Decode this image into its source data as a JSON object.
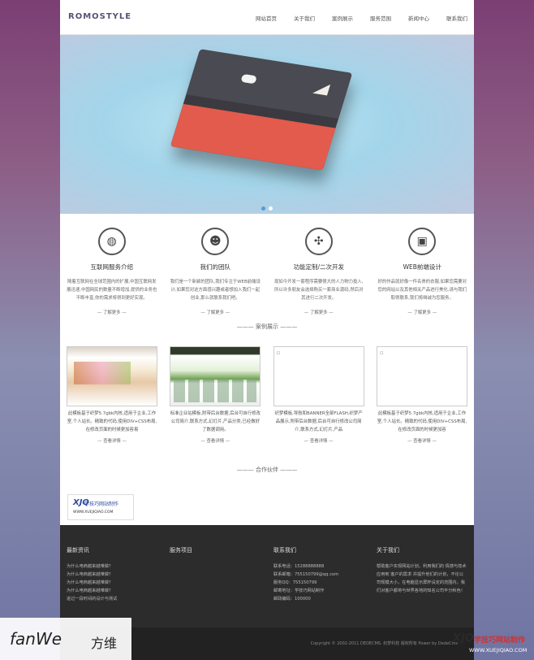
{
  "brand": "ROMOSTYLE",
  "nav": [
    "网站首页",
    "关于我们",
    "案例展示",
    "服务范围",
    "新闻中心",
    "联系我们"
  ],
  "banner": {
    "slides": 2,
    "active_slide": 1
  },
  "services": [
    {
      "icon": "globe-icon",
      "glyph": "◍",
      "title": "互联网服务介绍",
      "desc": "随着互联网在全球范围内的扩展,中国互联网发展迅速,中国网民的数量不断增加,提供的业务也不断丰富,你的需求将得到更好实现。",
      "more": "— 了解更多 —"
    },
    {
      "icon": "team-icon",
      "glyph": "☻",
      "title": "我们的团队",
      "desc": "我们是一个新颖的团队,我们专注于WEB前端设计,如果您对这方面感兴趣或者想加入我们一起创业,那么就联系我们吧。",
      "more": "— 了解更多 —"
    },
    {
      "icon": "compress-icon",
      "glyph": "✣",
      "title": "功能定制/二次开发",
      "desc": "现如今开发一套程序需要很大的人力物力投入,所以许多朋友会选择购买一套商业源码,然后对其进行二次开发。",
      "more": "— 了解更多 —"
    },
    {
      "icon": "laptop-icon",
      "glyph": "▣",
      "title": "WEB前端设计",
      "desc": "好的作品就好像一件名贵的衣服,如果您需要对您的网站以及其他相关产品进行美化,请与我们取得联系,我们将竭诚为您服务。",
      "more": "— 了解更多 —"
    }
  ],
  "cases_title": "——— 案例展示 ———",
  "cases": [
    {
      "desc": "此模板基于织梦5.7gbk内核,适用于企业,工作室,个人站长。精致的代码,使用DIV+CSS布局,在修改页面的时候更加容易",
      "more": "— 查看详情 —"
    },
    {
      "desc": "标准企业站模板,附带后台数据,后台可自行修改公司简介,联系方式,幻灯片,产品分类,已经做好了数据调用。",
      "more": "— 查看详情 —"
    },
    {
      "desc": "织梦模板,导航和BANNER全部FLASH,织梦产品展示,附带后台数据,后台可自行修改公司简介,联系方式,幻灯片,产品",
      "more": "— 查看详情 —"
    },
    {
      "desc": "此模板基于织梦5.7gbk内核,适用于企业,工作室,个人站长。精致的代码,使用DIV+CSS布局,在修改页面的时候更加容",
      "more": "— 查看详情 —"
    }
  ],
  "partners_title": "——— 合作伙伴 ———",
  "partner": {
    "mark": "XJQ",
    "name": "学技巧网站制作",
    "url": "WWW.XUEJIQIAO.COM"
  },
  "footer": {
    "news": {
      "title": "最新资讯",
      "items": [
        "为什么电商越来越难做？",
        "为什么电商越来越难做？",
        "为什么电商越来越难做？",
        "为什么电商越来越难做？",
        "进过一段时间的设计与测试"
      ]
    },
    "services": {
      "title": "服务项目"
    },
    "contact": {
      "title": "联系我们",
      "items": [
        "联系电话：15288888888",
        "联系邮箱：755150799@qq.com",
        "服务QQ：755150799",
        "邮寄地址：学技巧网站制作",
        "邮政编码：100000"
      ]
    },
    "about": {
      "title": "关于我们",
      "text": "帮助客户实现网站计划，利用我们的 情感与技术 应用到 客户的需求 并提升他们的计划，不论公司规模大小，在电脑显示屏杯设定的范围内，我们对客户都将与世界各地的知名公司平分秋色！"
    },
    "copyright": "Copyright © 2002-2011 DEDECMS. 织梦科技 版权所有 Power by DedeCms"
  },
  "watermark_left": {
    "a": "fanWe",
    "b": "方维"
  },
  "watermark_right": {
    "a": "XJQ",
    "b": "学技巧网站制作",
    "c": "WWW.XUEJIQIAO.COM"
  }
}
